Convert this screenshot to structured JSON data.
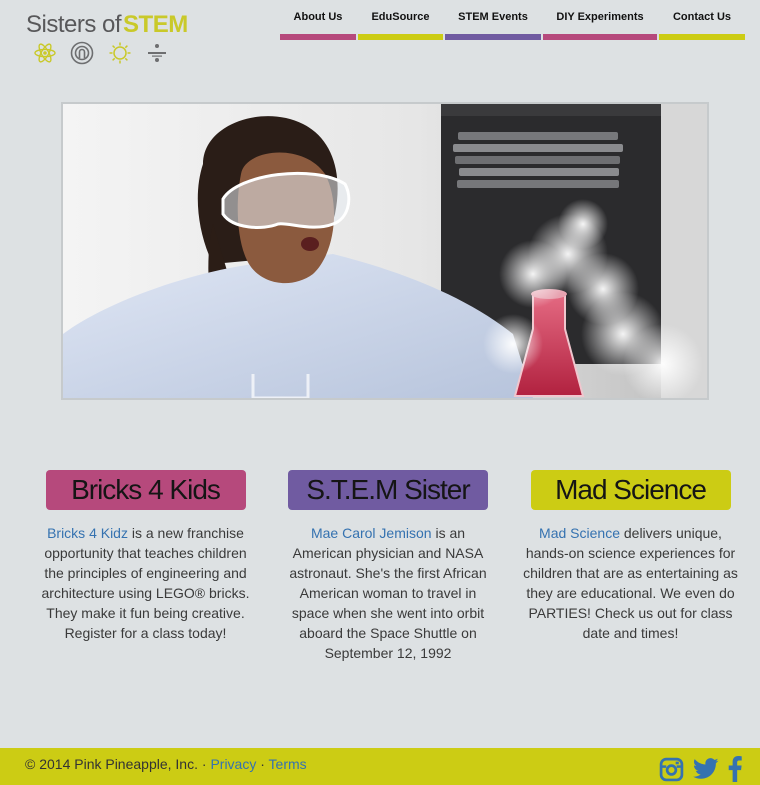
{
  "brand": {
    "name_part1": "Sisters of",
    "name_part2": "STEM",
    "colors": {
      "pink": "#b6497c",
      "yellow": "#cccc14",
      "purple": "#705ba1",
      "link": "#3572b0",
      "background": "#dde1e3"
    },
    "icons": [
      "atom-icon",
      "science-circle-icon",
      "gear-icon",
      "divide-icon"
    ]
  },
  "nav": {
    "items": [
      {
        "label": "About Us",
        "color": "pink"
      },
      {
        "label": "EduSource",
        "color": "yellow"
      },
      {
        "label": "STEM Events",
        "color": "purple"
      },
      {
        "label": "DIY Experiments",
        "color": "pink"
      },
      {
        "label": "Contact Us",
        "color": "yellow"
      }
    ]
  },
  "hero": {
    "image": "girl-with-safety-goggles-and-smoking-flask-photo"
  },
  "cards": [
    {
      "title": "Bricks 4 Kids",
      "color": "pink",
      "link_text": "Bricks 4 Kidz",
      "body": " is a new franchise opportunity that teaches children the principles of engineering and architecture using LEGO® bricks. They make it fun being creative. Register for a class today!"
    },
    {
      "title": "S.T.E.M Sister",
      "color": "purple",
      "link_text": "Mae Carol Jemison",
      "body": " is an American physician and NASA astronaut. She's the first African American woman to travel in space when she went into orbit aboard the Space Shuttle on September 12, 1992"
    },
    {
      "title": "Mad Science",
      "color": "yellow",
      "link_text": "Mad Science",
      "body": " delivers unique, hands-on science experiences for children that are as entertaining as they are educational. We even do PARTIES! Check us out for class date and times!"
    }
  ],
  "footer": {
    "copyright": "© 2014 Pink Pineapple, Inc. · ",
    "privacy": "Privacy",
    "separator": " · ",
    "terms": "Terms",
    "social": [
      "instagram-icon",
      "twitter-icon",
      "facebook-icon"
    ]
  }
}
